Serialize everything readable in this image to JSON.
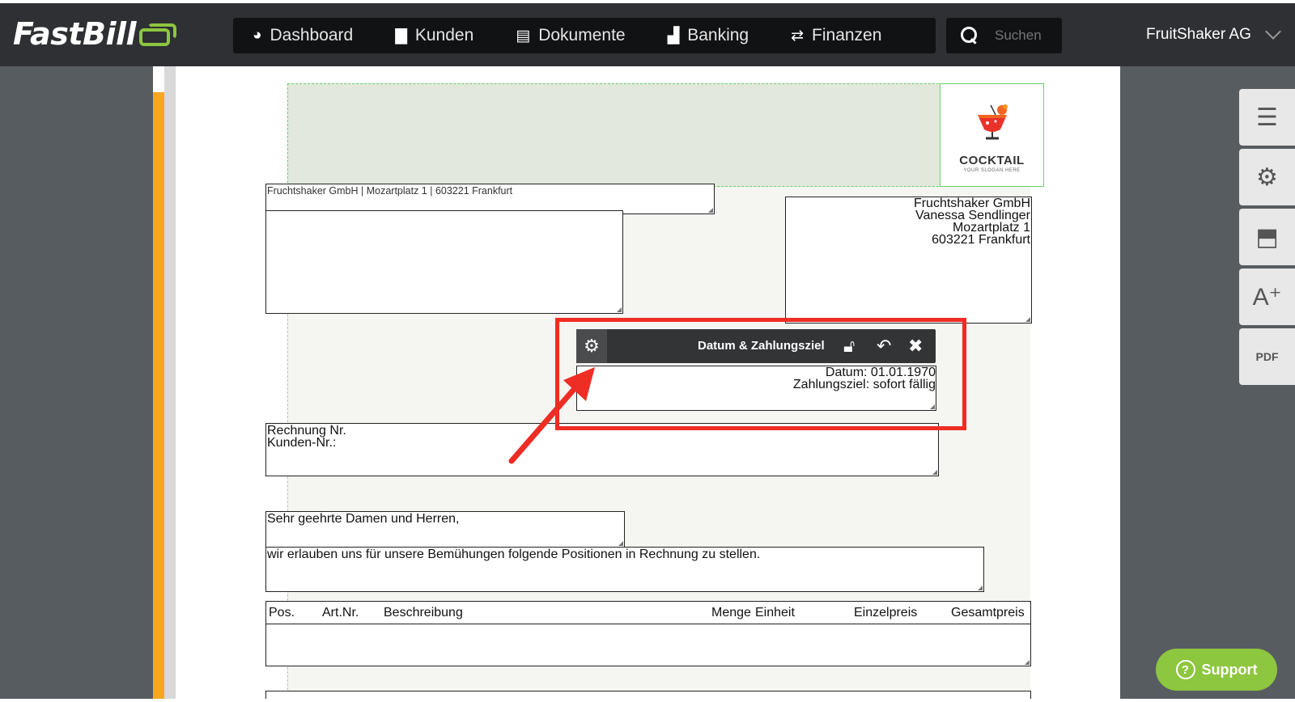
{
  "brand": {
    "name": "FastBill"
  },
  "nav": {
    "items": [
      {
        "label": "Dashboard",
        "icon": "dashboard-icon"
      },
      {
        "label": "Kunden",
        "icon": "briefcase-icon"
      },
      {
        "label": "Dokumente",
        "icon": "document-icon"
      },
      {
        "label": "Banking",
        "icon": "bar-chart-icon"
      },
      {
        "label": "Finanzen",
        "icon": "transfer-icon"
      }
    ]
  },
  "search": {
    "placeholder": "Suchen"
  },
  "account": {
    "name": "FruitShaker AG"
  },
  "logo_block": {
    "title": "COCKTAIL",
    "slogan": "YOUR SLOGAN HERE"
  },
  "document": {
    "sender_line": "Fruchtshaker GmbH | Mozartplatz 1 | 603221 Frankfurt",
    "address": {
      "company": "Fruchtshaker GmbH",
      "person": "Vanessa Sendlinger",
      "street": "Mozartplatz 1",
      "city": "603221 Frankfurt"
    },
    "date_block": {
      "date": "Datum: 01.01.1970",
      "due": "Zahlungsziel: sofort fällig"
    },
    "invoice": {
      "number_label": "Rechnung Nr.",
      "customer_label": "Kunden-Nr.:"
    },
    "greeting": "Sehr geehrte Damen und Herren,",
    "intro": "wir erlauben uns für unsere Bemühungen folgende Positionen in Rechnung zu stellen.",
    "table_headers": [
      "Pos.",
      "Art.Nr.",
      "Beschreibung",
      "Menge",
      "Einheit",
      "Einzelpreis",
      "Gesamtpreis"
    ]
  },
  "toolbar": {
    "title": "Datum & Zahlungsziel"
  },
  "right_tools": [
    {
      "icon": "collapse-panel-icon"
    },
    {
      "icon": "settings-icon"
    },
    {
      "icon": "image-upload-icon"
    },
    {
      "icon": "add-text-icon"
    },
    {
      "icon": "pdf-download-icon"
    }
  ],
  "support": {
    "label": "Support"
  },
  "colors": {
    "accent": "#8dc63f",
    "highlight": "#ee2d24",
    "orange": "#f5a623"
  }
}
